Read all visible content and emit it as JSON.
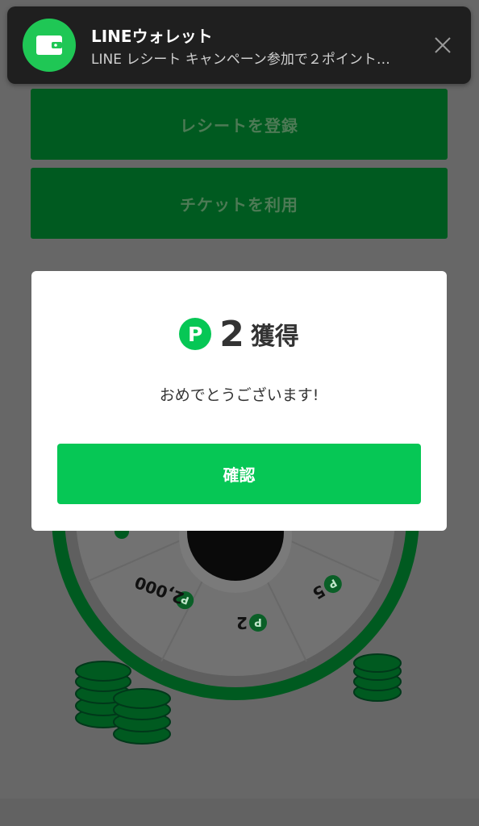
{
  "colors": {
    "overlay_bg": "#676767",
    "line_green": "#06c755",
    "dim_button_bg": "#005a20",
    "notification_bg": "#1f1f1f",
    "dialog_bg": "#ffffff"
  },
  "notification": {
    "app_icon": "wallet-icon",
    "title": "LINEウォレット",
    "body": "LINE レシート キャンペーン参加で２ポイント…",
    "close_icon": "close-icon"
  },
  "background_actions": {
    "register_receipt_label": "レシートを登録",
    "use_ticket_label": "チケットを利用"
  },
  "roulette": {
    "segment_labels": [
      "2,000",
      "2",
      "5"
    ],
    "point_icon_letter": "P"
  },
  "dialog": {
    "point_icon_letter": "P",
    "reward_amount": "2",
    "reward_suffix": "獲得",
    "message": "おめでとうございます!",
    "confirm_label": "確認"
  }
}
